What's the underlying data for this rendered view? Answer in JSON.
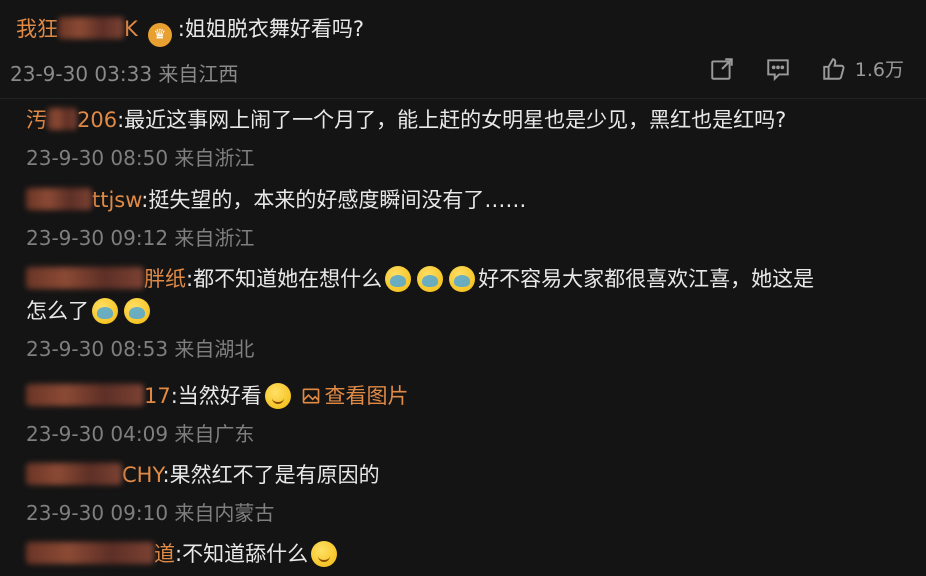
{
  "main": {
    "username_prefix": "我狂",
    "username_suffix": "K",
    "comment": ":姐姐脱衣舞好看吗?",
    "meta": "23-9-30 03:33 来自江西",
    "like_count": "1.6万",
    "icons": [
      "share-icon",
      "comment-icon",
      "like-icon",
      "vip-badge-icon"
    ]
  },
  "replies": [
    {
      "name_prefix": "汚",
      "name_suffix": "206",
      "text": ":最近这事网上闹了一个月了，能上赶的女明星也是少见，黑红也是红吗?",
      "meta": "23-9-30 08:50 来自浙江"
    },
    {
      "name_prefix": "",
      "name_suffix": "ttjsw",
      "text": ":挺失望的，本来的好感度瞬间没有了……",
      "meta": "23-9-30 09:12 来自浙江"
    },
    {
      "name_prefix": "",
      "name_suffix": "胖纸",
      "text_before": ":都不知道她在想什么",
      "text_after": "好不容易大家都很喜欢江喜，她这是",
      "text_line2": "怎么了",
      "meta": "23-9-30 08:53 来自湖北"
    },
    {
      "name_prefix": "",
      "name_suffix": "17",
      "text": ":当然好看",
      "link": "查看图片",
      "meta": "23-9-30 04:09 来自广东"
    },
    {
      "name_prefix": "",
      "name_suffix": "CHY",
      "text": ":果然红不了是有原因的",
      "meta": "23-9-30 09:10 来自内蒙古"
    },
    {
      "name_prefix": "",
      "name_suffix": "道",
      "text": ":不知道舔什么"
    }
  ]
}
